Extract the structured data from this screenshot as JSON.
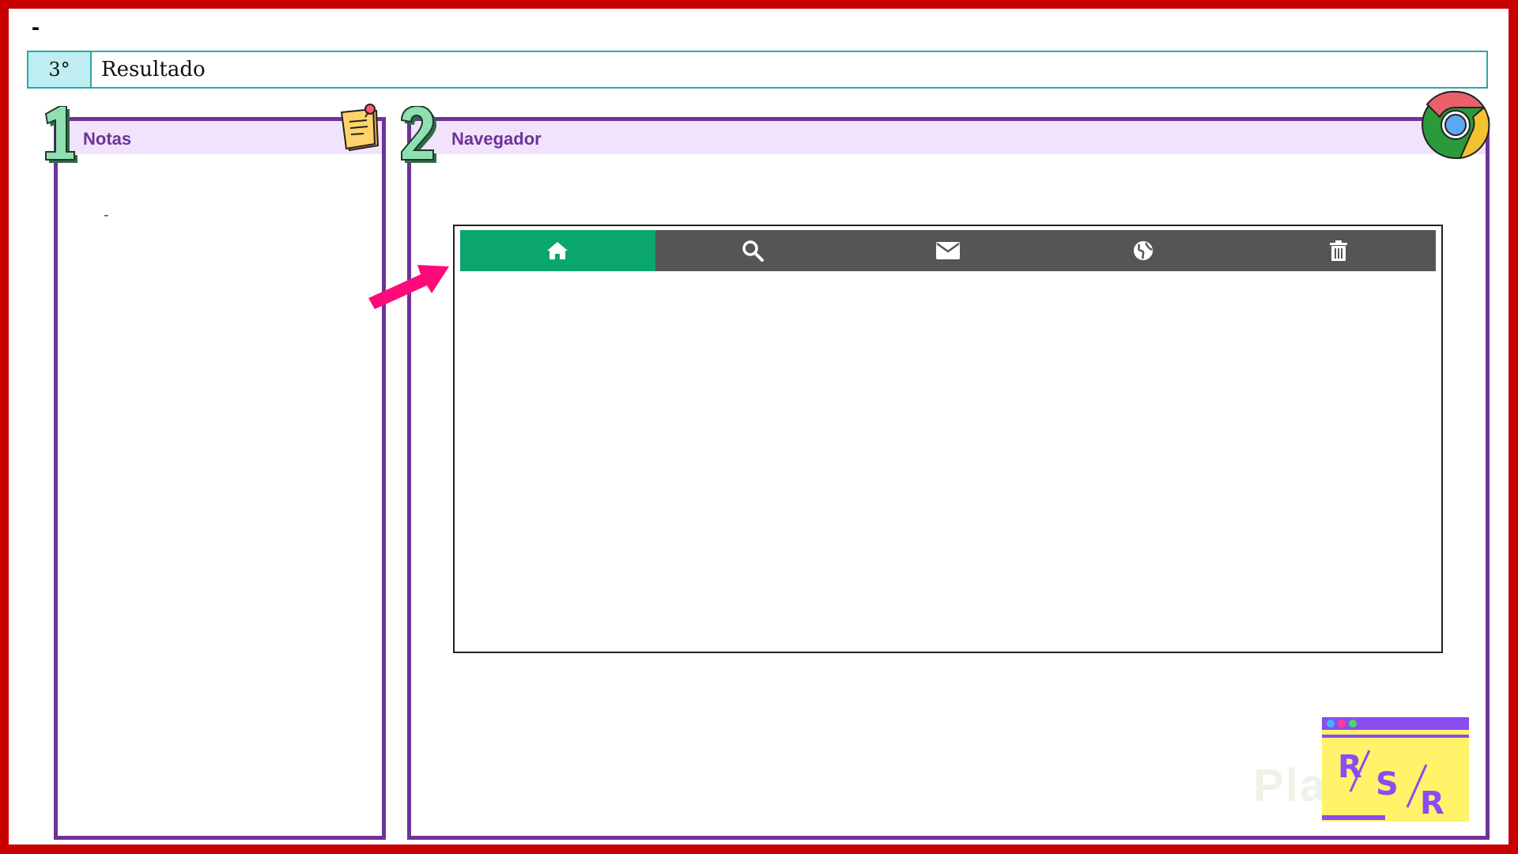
{
  "header": {
    "top_dash": "-",
    "step_number": "3°",
    "step_title": "Resultado"
  },
  "panels": {
    "notes": {
      "number": "1",
      "title": "Notas",
      "content": "-"
    },
    "browser": {
      "number": "2",
      "title": "Navegador"
    }
  },
  "browser_mock": {
    "nav_items": [
      {
        "icon": "home-icon",
        "active": true
      },
      {
        "icon": "search-icon",
        "active": false
      },
      {
        "icon": "mail-icon",
        "active": false
      },
      {
        "icon": "globe-icon",
        "active": false
      },
      {
        "icon": "trash-icon",
        "active": false
      }
    ],
    "colors": {
      "active": "#0ba66c",
      "bar": "#555555"
    }
  },
  "branding": {
    "logo_letters": [
      "R",
      "S",
      "R"
    ],
    "watermark": "Platzi"
  },
  "colors": {
    "frame": "#c80000",
    "panel_border": "#6e3399",
    "panel_head": "#f1e3fb",
    "step_accent": "#2aa8a8",
    "arrow": "#ff0a7a"
  }
}
